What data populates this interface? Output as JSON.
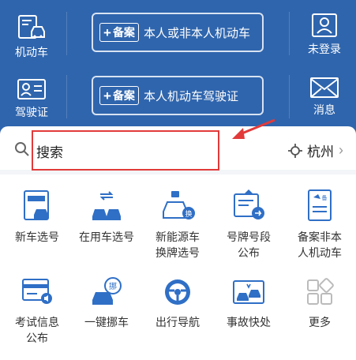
{
  "header": {
    "left_items": [
      {
        "label": "机动车",
        "icon": "car-doc-icon"
      },
      {
        "label": "驾驶证",
        "icon": "id-card-icon"
      }
    ],
    "right_items": [
      {
        "label": "未登录",
        "icon": "user-icon"
      },
      {
        "label": "消息",
        "icon": "mail-icon"
      }
    ],
    "banners": [
      {
        "tag": "备案",
        "text": "本人或非本人机动车"
      },
      {
        "tag": "备案",
        "text": "本人机动车驾驶证"
      }
    ]
  },
  "search": {
    "placeholder": "搜索",
    "city": "杭州"
  },
  "grid": [
    {
      "label": "新车选号",
      "icon": "new-car-plate-icon"
    },
    {
      "label": "在用车选号",
      "icon": "used-car-plate-icon"
    },
    {
      "label": "新能源车换牌选号",
      "label_lines": [
        "新能源车",
        "换牌选号"
      ],
      "icon": "ev-car-icon"
    },
    {
      "label": "号牌号段公布",
      "label_lines": [
        "号牌号段",
        "公布"
      ],
      "icon": "plate-segment-icon"
    },
    {
      "label": "备案非本人机动车",
      "label_lines": [
        "备案非本",
        "人机动车"
      ],
      "icon": "register-doc-icon"
    },
    {
      "label": "考试信息公布",
      "label_lines": [
        "考试信息",
        "公布"
      ],
      "icon": "exam-info-icon"
    },
    {
      "label": "一键挪车",
      "icon": "move-car-icon"
    },
    {
      "label": "出行导航",
      "icon": "steering-wheel-icon"
    },
    {
      "label": "事故快处",
      "icon": "accident-icon"
    },
    {
      "label": "更多",
      "icon": "more-grid-icon"
    }
  ],
  "colors": {
    "brand": "#2f65ad",
    "icon_blue": "#2f6fc6",
    "highlight": "#e23a3a"
  }
}
